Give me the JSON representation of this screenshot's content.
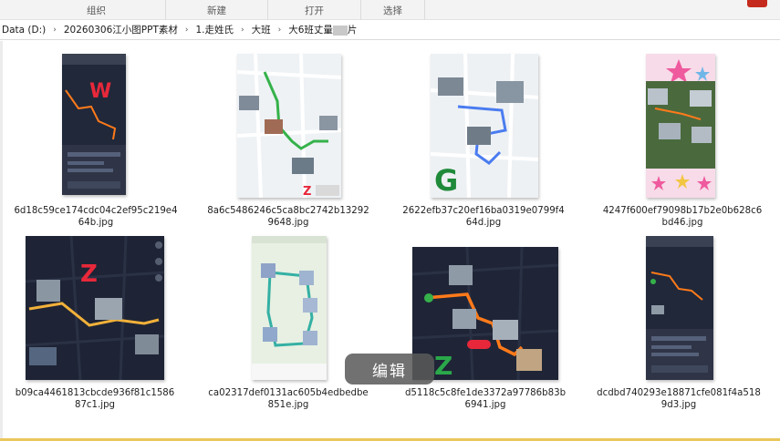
{
  "ribbon": {
    "groups": [
      "组织",
      "新建",
      "打开",
      "选择"
    ]
  },
  "breadcrumb": [
    "Data (D:)",
    "20260306江小图PPT素材",
    "1.走姓氏",
    "大班",
    "大6班丈量",
    "片"
  ],
  "files": [
    {
      "name": "6d18c59ce174cdc04c2ef95c219e464b.jpg",
      "letter": "W"
    },
    {
      "name": "8a6c5486246c5ca8bc2742b132929648.jpg",
      "letter": "Z"
    },
    {
      "name": "2622efb37c20ef16ba0319e0799f464d.jpg",
      "letter": "G"
    },
    {
      "name": "4247f600ef79098b17b2e0b628c6bd46.jpg",
      "letter": ""
    },
    {
      "name": "b09ca4461813cbcde936f81c158687c1.jpg",
      "letter": "Z"
    },
    {
      "name": "ca02317def0131ac605b4edbedbe851e.jpg",
      "letter": ""
    },
    {
      "name": "d5118c5c8fe1de3372a97786b83b6941.jpg",
      "letter": "Z"
    },
    {
      "name": "dcdbd740293e18871cfe081f4a5189d3.jpg",
      "letter": ""
    }
  ],
  "toast": {
    "label": "编辑"
  },
  "colors": {
    "route_orange": "#ff7a1a",
    "route_green": "#35b24a",
    "route_blue": "#4a7cf0",
    "dark_map": "#1c2233"
  }
}
